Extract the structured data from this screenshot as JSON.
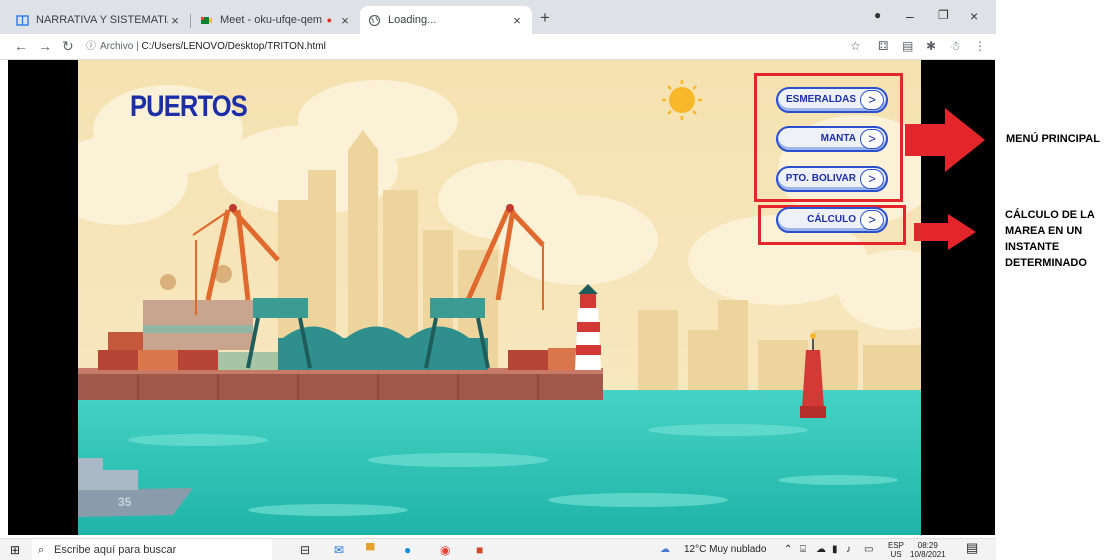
{
  "browser": {
    "tabs": [
      {
        "title": "NARRATIVA Y SISTEMATIZACIÓN"
      },
      {
        "title": "Meet - oku-ufqe-qem"
      },
      {
        "title": "Loading..."
      }
    ],
    "new_tab_label": "+",
    "address": {
      "info_label": "Archivo",
      "url": "C:/Users/LENOVO/Desktop/TRITON.html"
    }
  },
  "page": {
    "title": "PUERTOS",
    "menu": [
      {
        "label": "ESMERALDAS",
        "arrow": ">"
      },
      {
        "label": "MANTA",
        "arrow": ">"
      },
      {
        "label": "PTO. BOLIVAR",
        "arrow": ">"
      }
    ],
    "calc": {
      "label": "CÁLCULO",
      "arrow": ">"
    },
    "ship_number": "35"
  },
  "annotations": {
    "menu_principal": "MENÚ PRINCIPAL",
    "calculo_lines": [
      "CÁLCULO DE LA",
      "MAREA EN UN",
      "INSTANTE",
      "DETERMINADO"
    ]
  },
  "taskbar": {
    "search_placeholder": "Escribe aquí para buscar",
    "weather": "12°C  Muy nublado",
    "lang_top": "ESP",
    "lang_bottom": "US",
    "time": "08:29",
    "date": "10/8/2021"
  },
  "colors": {
    "title_blue": "#1c2fa8",
    "annotation_red": "#e3262b",
    "sea": "#2fc4b6",
    "sky": "#f3dfa8"
  }
}
